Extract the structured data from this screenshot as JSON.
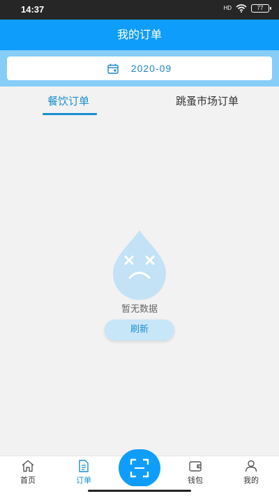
{
  "status_bar": {
    "time": "14:37",
    "network": "HD",
    "battery": "77"
  },
  "header": {
    "title": "我的订单"
  },
  "date_filter": {
    "value": "2020-09"
  },
  "tabs": [
    {
      "label": "餐饮订单",
      "active": true
    },
    {
      "label": "跳蚤市场订单",
      "active": false
    }
  ],
  "empty_state": {
    "message": "暂无数据",
    "refresh_label": "刷新"
  },
  "bottom_nav": {
    "items": [
      {
        "label": "首页"
      },
      {
        "label": "订单",
        "active": true
      },
      {
        "label": "钱包"
      },
      {
        "label": "我的"
      }
    ]
  },
  "colors": {
    "primary": "#0f9dfb",
    "accent_text": "#1a8fd1",
    "date_band": "#86cdf7",
    "background": "#f2f2f2"
  }
}
